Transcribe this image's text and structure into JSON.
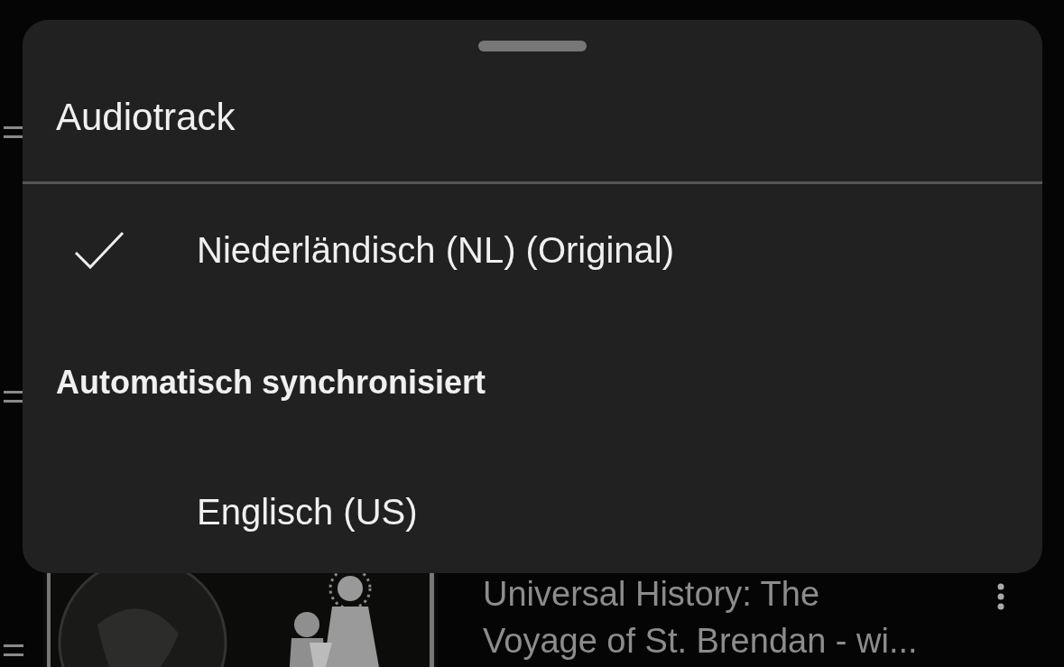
{
  "video": {
    "title": "Universal History: The Voyage of St. Brendan - wi..."
  },
  "sheet": {
    "title": "Audiotrack",
    "items": [
      {
        "kind": "option",
        "label": "Niederländisch (NL) (Original)",
        "selected": true
      },
      {
        "kind": "heading",
        "label": "Automatisch synchronisiert"
      },
      {
        "kind": "option",
        "label": "Englisch (US)",
        "selected": false
      }
    ]
  }
}
